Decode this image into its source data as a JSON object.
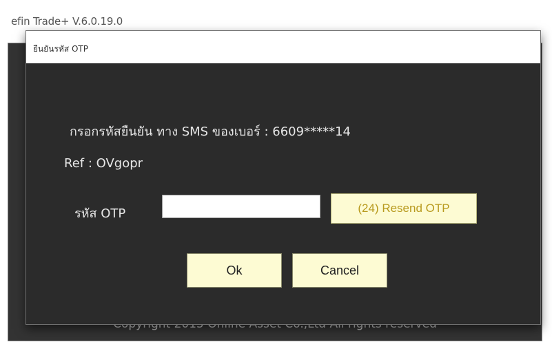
{
  "outer_window": {
    "title": "efin Trade+ V.6.0.19.0",
    "footer": "Copyright 2015 Online Asset Co.,Ltd  All rights reserved"
  },
  "dialog": {
    "title": "ยืนยันรหัส OTP",
    "instruction": "กรอกรหัสยืนยัน ทาง SMS ของเบอร์ : 6609*****14",
    "ref": "Ref : OVgopr",
    "otp_label": "รหัส OTP",
    "otp_value": "",
    "resend_label": "(24) Resend OTP",
    "ok_label": "Ok",
    "cancel_label": "Cancel"
  },
  "colors": {
    "dialog_bg": "#2b2b2b",
    "button_bg": "#fdfbd3",
    "resend_text": "#b89a1e"
  }
}
